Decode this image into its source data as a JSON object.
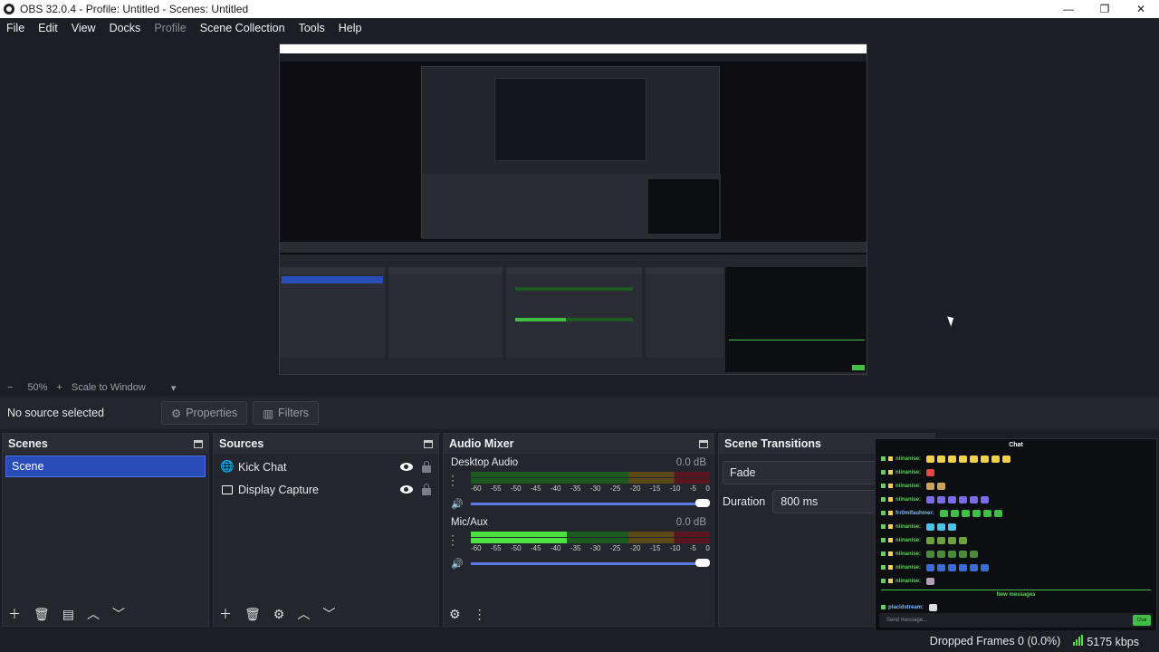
{
  "titlebar": {
    "title": "OBS 32.0.4 - Profile: Untitled - Scenes: Untitled",
    "minimize": "—",
    "maximize": "❐",
    "close": "✕"
  },
  "menu": [
    "File",
    "Edit",
    "View",
    "Docks",
    "Profile",
    "Scene Collection",
    "Tools",
    "Help"
  ],
  "zoom": {
    "minus": "−",
    "value": "50%",
    "plus": "+",
    "mode": "Scale to Window",
    "arrow": "▾"
  },
  "context": {
    "status": "No source selected",
    "properties": "Properties",
    "filters": "Filters"
  },
  "scenes": {
    "title": "Scenes",
    "items": [
      "Scene"
    ]
  },
  "sources": {
    "title": "Sources",
    "items": [
      {
        "label": "Kick Chat",
        "icon": "globe-icon"
      },
      {
        "label": "Display Capture",
        "icon": "monitor-icon"
      }
    ]
  },
  "mixer": {
    "title": "Audio Mixer",
    "channels": [
      {
        "name": "Desktop Audio",
        "db": "0.0 dB",
        "level": 0.0
      },
      {
        "name": "Mic/Aux",
        "db": "0.0 dB",
        "level": 0.4
      }
    ],
    "scale": [
      "-60",
      "-55",
      "-50",
      "-45",
      "-40",
      "-35",
      "-30",
      "-25",
      "-20",
      "-15",
      "-10",
      "-5",
      "0"
    ]
  },
  "transitions": {
    "title": "Scene Transitions",
    "selected": "Fade",
    "duration_label": "Duration",
    "duration_value": "800 ms"
  },
  "chat": {
    "title": "Chat",
    "lines": [
      {
        "user": "niinanise:"
      },
      {
        "user": "niinanise:"
      },
      {
        "user": "niinanise:"
      },
      {
        "user": "niinanise:"
      },
      {
        "user": "frr0mlfauhmer:"
      },
      {
        "user": "niinanise:"
      },
      {
        "user": "niinanise:"
      },
      {
        "user": "niinanise:"
      },
      {
        "user": "niinanise:"
      },
      {
        "user": "niinanise:"
      }
    ],
    "new_messages": "New messages",
    "last_user": "placidstream:",
    "input_placeholder": "Send message...",
    "send": "Chat"
  },
  "status": {
    "dropped": "Dropped Frames 0 (0.0%)",
    "bitrate": "5175 kbps"
  },
  "colors": {
    "accent": "#284cb8",
    "meter_green": "#4ce040",
    "background": "#1c1e25",
    "panel": "#24262e"
  }
}
